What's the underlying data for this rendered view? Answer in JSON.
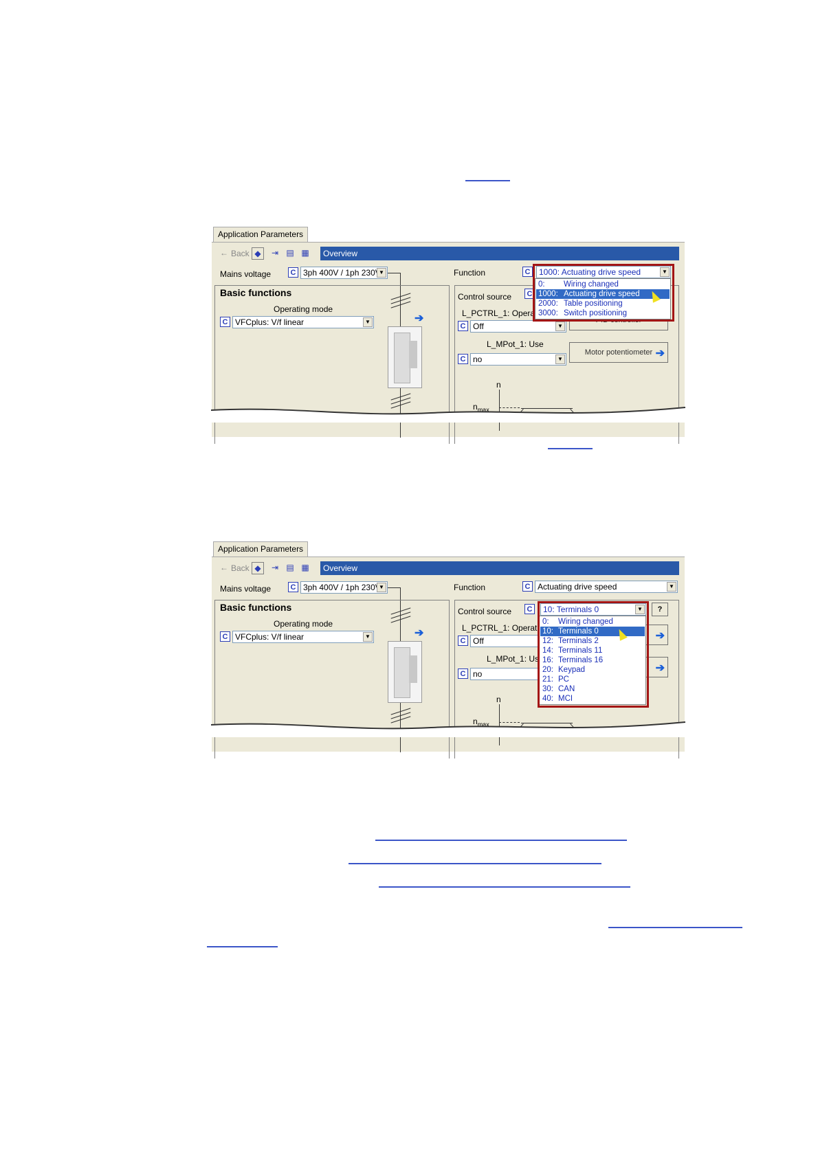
{
  "screenshots": [
    {
      "tab": "Application Parameters",
      "back": "Back",
      "overview": "Overview",
      "mains_voltage_label": "Mains voltage",
      "mains_voltage_value": "3ph 400V / 1ph 230V",
      "function_label": "Function",
      "function_value": "1000:  Actuating drive speed",
      "basic_functions": "Basic functions",
      "operating_mode_label": "Operating mode",
      "operating_mode_value": "VFCplus: V/f linear",
      "control_source_label": "Control source",
      "pctrl_label": "L_PCTRL_1: Operating",
      "pctrl_value": "Off",
      "mpot_label": "L_MPot_1: Use",
      "mpot_value": "no",
      "pid_button": "PID controller",
      "motor_pot_button": "Motor potentiometer",
      "n_label": "n",
      "nmax_label": "n",
      "nmax_sub": "max",
      "dropdown": [
        {
          "num": "0:",
          "label": "Wiring changed"
        },
        {
          "num": "1000:",
          "label": "Actuating drive speed"
        },
        {
          "num": "2000:",
          "label": "Table positioning"
        },
        {
          "num": "3000:",
          "label": "Switch positioning"
        }
      ]
    },
    {
      "tab": "Application Parameters",
      "back": "Back",
      "overview": "Overview",
      "mains_voltage_label": "Mains voltage",
      "mains_voltage_value": "3ph 400V / 1ph 230V",
      "function_label": "Function",
      "function_value": "Actuating drive speed",
      "basic_functions": "Basic functions",
      "operating_mode_label": "Operating mode",
      "operating_mode_value": "VFCplus: V/f linear",
      "control_source_label": "Control source",
      "control_source_value": "10:  Terminals 0",
      "help_button": "?",
      "pctrl_label": "L_PCTRL_1: Operating",
      "pctrl_value": "Off",
      "mpot_label": "L_MPot_1: Use",
      "mpot_value": "no",
      "motor_pot_button_partial": "er",
      "n_label": "n",
      "nmax_label": "n",
      "nmax_sub": "max",
      "dropdown": [
        {
          "num": "0:",
          "label": "Wiring changed"
        },
        {
          "num": "10:",
          "label": "Terminals 0"
        },
        {
          "num": "12:",
          "label": "Terminals 2"
        },
        {
          "num": "14:",
          "label": "Terminals 11"
        },
        {
          "num": "16:",
          "label": "Terminals 16"
        },
        {
          "num": "20:",
          "label": "Keypad"
        },
        {
          "num": "21:",
          "label": "PC"
        },
        {
          "num": "30:",
          "label": "CAN"
        },
        {
          "num": "40:",
          "label": "MCI"
        }
      ]
    }
  ],
  "colors": {
    "link": "#3b55c8",
    "panel": "#ece9d8",
    "title_bar": "#2959a8",
    "selection": "#316ac5",
    "highlight_frame": "#a31515"
  }
}
